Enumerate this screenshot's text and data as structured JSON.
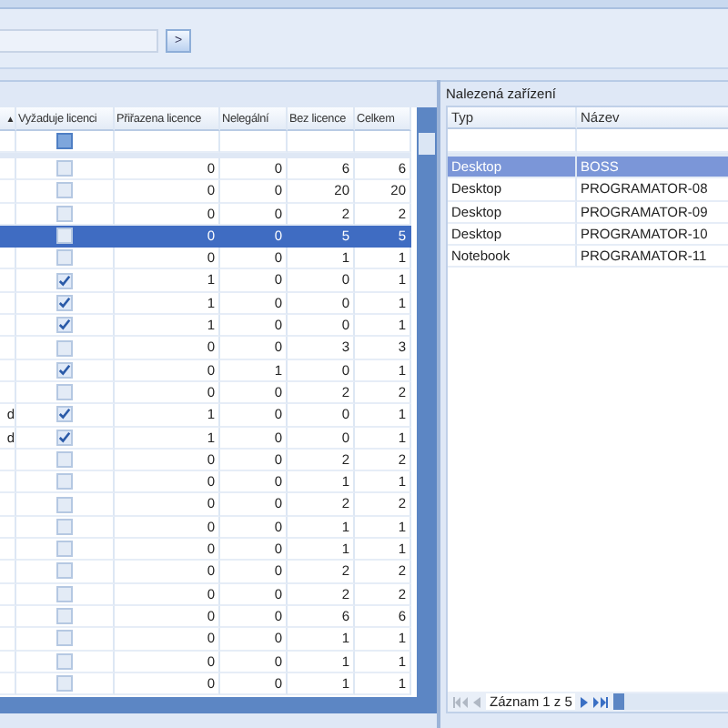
{
  "search": {
    "button": ">"
  },
  "left_grid": {
    "sort_indicator": "▲",
    "columns": [
      "Vyžaduje licenci",
      "Přiřazena licence",
      "Nelegální",
      "Bez licence",
      "Celkem"
    ],
    "rows": [
      {
        "column_1": "",
        "checked": false,
        "assigned": "0",
        "illegal": "0",
        "unlicensed": "6",
        "total": "6",
        "selected": false
      },
      {
        "column_1": "",
        "checked": false,
        "assigned": "0",
        "illegal": "0",
        "unlicensed": "20",
        "total": "20",
        "selected": false
      },
      {
        "column_1": "",
        "checked": false,
        "assigned": "0",
        "illegal": "0",
        "unlicensed": "2",
        "total": "2",
        "selected": false
      },
      {
        "column_1": "",
        "checked": false,
        "assigned": "0",
        "illegal": "0",
        "unlicensed": "5",
        "total": "5",
        "selected": true
      },
      {
        "column_1": "",
        "checked": false,
        "assigned": "0",
        "illegal": "0",
        "unlicensed": "1",
        "total": "1",
        "selected": false
      },
      {
        "column_1": "",
        "checked": true,
        "assigned": "1",
        "illegal": "0",
        "unlicensed": "0",
        "total": "1",
        "selected": false
      },
      {
        "column_1": "",
        "checked": true,
        "assigned": "1",
        "illegal": "0",
        "unlicensed": "0",
        "total": "1",
        "selected": false
      },
      {
        "column_1": "",
        "checked": true,
        "assigned": "1",
        "illegal": "0",
        "unlicensed": "0",
        "total": "1",
        "selected": false
      },
      {
        "column_1": "",
        "checked": false,
        "assigned": "0",
        "illegal": "0",
        "unlicensed": "3",
        "total": "3",
        "selected": false
      },
      {
        "column_1": "",
        "checked": true,
        "assigned": "0",
        "illegal": "1",
        "unlicensed": "0",
        "total": "1",
        "selected": false
      },
      {
        "column_1": "",
        "checked": false,
        "assigned": "0",
        "illegal": "0",
        "unlicensed": "2",
        "total": "2",
        "selected": false
      },
      {
        "column_1": "d",
        "checked": true,
        "assigned": "1",
        "illegal": "0",
        "unlicensed": "0",
        "total": "1",
        "selected": false
      },
      {
        "column_1": "d",
        "checked": true,
        "assigned": "1",
        "illegal": "0",
        "unlicensed": "0",
        "total": "1",
        "selected": false
      },
      {
        "column_1": "",
        "checked": false,
        "assigned": "0",
        "illegal": "0",
        "unlicensed": "2",
        "total": "2",
        "selected": false
      },
      {
        "column_1": "",
        "checked": false,
        "assigned": "0",
        "illegal": "0",
        "unlicensed": "1",
        "total": "1",
        "selected": false
      },
      {
        "column_1": "",
        "checked": false,
        "assigned": "0",
        "illegal": "0",
        "unlicensed": "2",
        "total": "2",
        "selected": false
      },
      {
        "column_1": "",
        "checked": false,
        "assigned": "0",
        "illegal": "0",
        "unlicensed": "1",
        "total": "1",
        "selected": false
      },
      {
        "column_1": "",
        "checked": false,
        "assigned": "0",
        "illegal": "0",
        "unlicensed": "1",
        "total": "1",
        "selected": false
      },
      {
        "column_1": "",
        "checked": false,
        "assigned": "0",
        "illegal": "0",
        "unlicensed": "2",
        "total": "2",
        "selected": false
      },
      {
        "column_1": "",
        "checked": false,
        "assigned": "0",
        "illegal": "0",
        "unlicensed": "2",
        "total": "2",
        "selected": false
      },
      {
        "column_1": "",
        "checked": false,
        "assigned": "0",
        "illegal": "0",
        "unlicensed": "6",
        "total": "6",
        "selected": false
      },
      {
        "column_1": "",
        "checked": false,
        "assigned": "0",
        "illegal": "0",
        "unlicensed": "1",
        "total": "1",
        "selected": false
      },
      {
        "column_1": "",
        "checked": false,
        "assigned": "0",
        "illegal": "0",
        "unlicensed": "1",
        "total": "1",
        "selected": false
      },
      {
        "column_1": "",
        "checked": false,
        "assigned": "0",
        "illegal": "0",
        "unlicensed": "1",
        "total": "1",
        "selected": false
      }
    ]
  },
  "devices": {
    "title": "Nalezená zařízení",
    "columns": [
      "Typ",
      "Název"
    ],
    "rows": [
      {
        "type": "Desktop",
        "name": "BOSS",
        "selected": true
      },
      {
        "type": "Desktop",
        "name": "PROGRAMATOR-08",
        "selected": false
      },
      {
        "type": "Desktop",
        "name": "PROGRAMATOR-09",
        "selected": false
      },
      {
        "type": "Desktop",
        "name": "PROGRAMATOR-10",
        "selected": false
      },
      {
        "type": "Notebook",
        "name": "PROGRAMATOR-11",
        "selected": false
      }
    ],
    "pager": "Záznam 1 z 5"
  }
}
